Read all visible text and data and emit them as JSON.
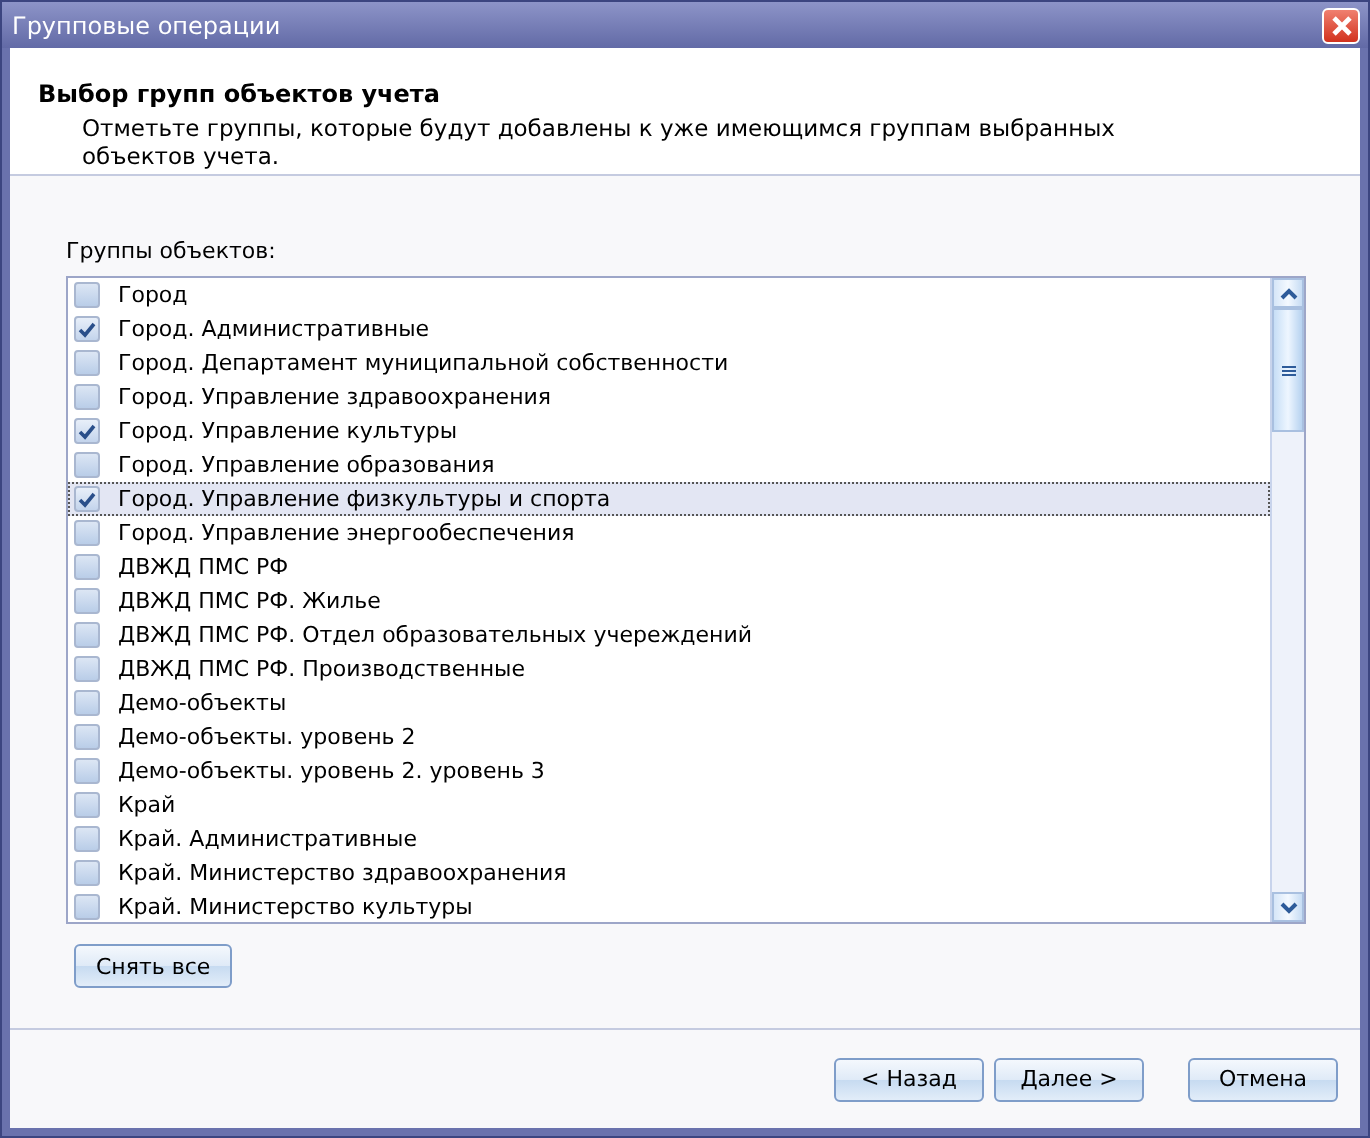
{
  "window": {
    "title": "Групповые операции"
  },
  "header": {
    "title": "Выбор групп объектов учета",
    "description": "Отметьте группы, которые будут добавлены к уже имеющимся группам выбранных объектов учета."
  },
  "groups": {
    "label": "Группы объектов:",
    "items": [
      {
        "label": "Город",
        "checked": false,
        "selected": false
      },
      {
        "label": "Город. Административные",
        "checked": true,
        "selected": false
      },
      {
        "label": "Город. Департамент муниципальной собственности",
        "checked": false,
        "selected": false
      },
      {
        "label": "Город. Управление здравоохранения",
        "checked": false,
        "selected": false
      },
      {
        "label": "Город. Управление культуры",
        "checked": true,
        "selected": false
      },
      {
        "label": "Город. Управление образования",
        "checked": false,
        "selected": false
      },
      {
        "label": "Город. Управление физкультуры и спорта",
        "checked": true,
        "selected": true
      },
      {
        "label": "Город. Управление энергообеспечения",
        "checked": false,
        "selected": false
      },
      {
        "label": "ДВЖД ПМС РФ",
        "checked": false,
        "selected": false
      },
      {
        "label": "ДВЖД ПМС РФ. Жилье",
        "checked": false,
        "selected": false
      },
      {
        "label": "ДВЖД ПМС РФ. Отдел образовательных учереждений",
        "checked": false,
        "selected": false
      },
      {
        "label": "ДВЖД ПМС РФ. Производственные",
        "checked": false,
        "selected": false
      },
      {
        "label": "Демо-объекты",
        "checked": false,
        "selected": false
      },
      {
        "label": "Демо-объекты. уровень 2",
        "checked": false,
        "selected": false
      },
      {
        "label": "Демо-объекты. уровень 2. уровень 3",
        "checked": false,
        "selected": false
      },
      {
        "label": "Край",
        "checked": false,
        "selected": false
      },
      {
        "label": "Край. Административные",
        "checked": false,
        "selected": false
      },
      {
        "label": "Край. Министерство здравоохранения",
        "checked": false,
        "selected": false
      },
      {
        "label": "Край. Министерство культуры",
        "checked": false,
        "selected": false
      }
    ]
  },
  "clear_button": "Снять все",
  "buttons": [
    "< Назад",
    "Далее >",
    "Отмена"
  ]
}
